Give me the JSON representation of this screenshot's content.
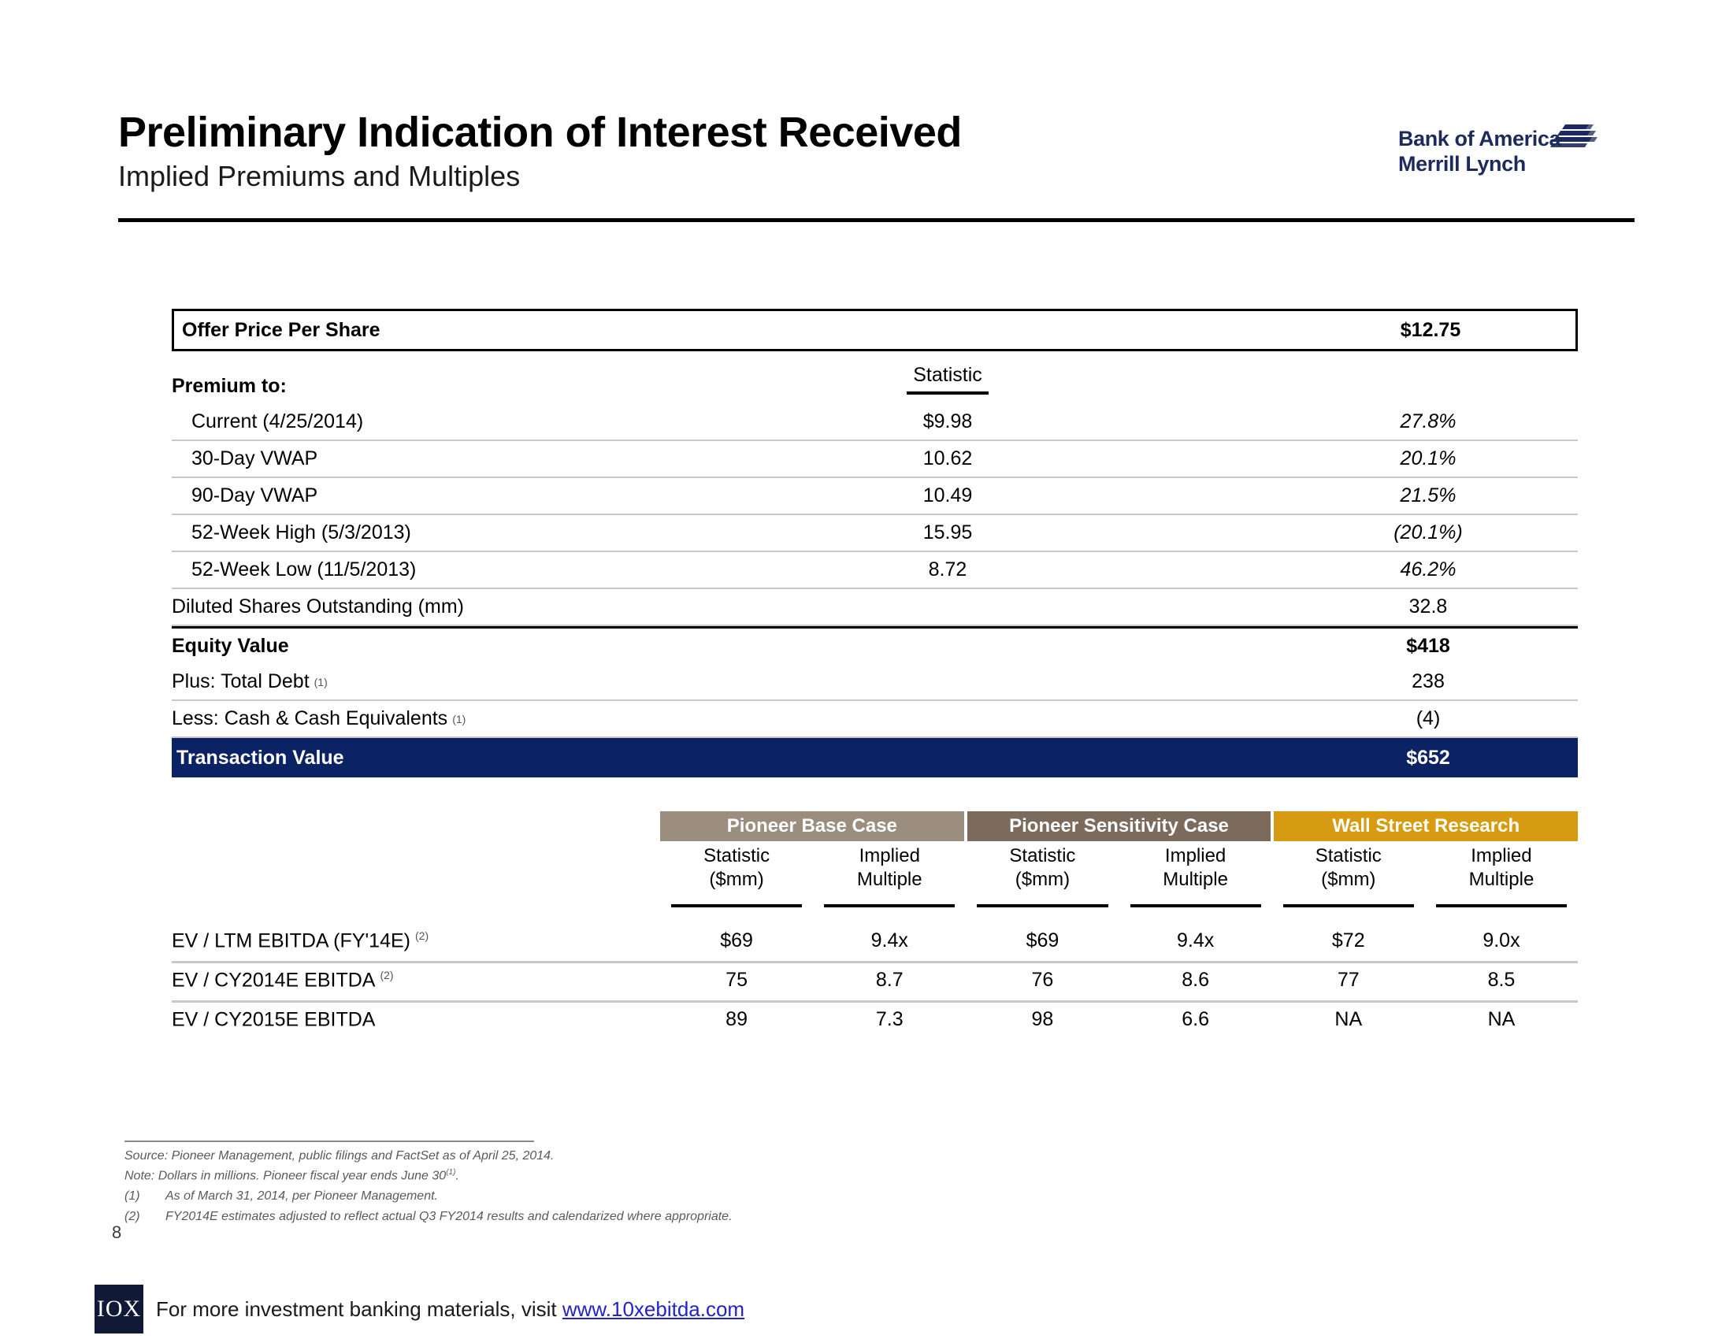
{
  "header": {
    "title": "Preliminary Indication of Interest Received",
    "subtitle": "Implied Premiums and Multiples",
    "logo": {
      "line1": "Bank of America",
      "line2": "Merrill Lynch"
    }
  },
  "premium_table": {
    "offer_label": "Offer Price Per Share",
    "offer_value": "$12.75",
    "premium_to_label": "Premium to:",
    "statistic_header": "Statistic",
    "rows": [
      {
        "label": "Current (4/25/2014)",
        "statistic": "$9.98",
        "premium": "27.8%"
      },
      {
        "label": "30-Day VWAP",
        "statistic": "10.62",
        "premium": "20.1%"
      },
      {
        "label": "90-Day VWAP",
        "statistic": "10.49",
        "premium": "21.5%"
      },
      {
        "label": "52-Week High (5/3/2013)",
        "statistic": "15.95",
        "premium": "(20.1%)"
      },
      {
        "label": "52-Week Low (11/5/2013)",
        "statistic": "8.72",
        "premium": "46.2%"
      }
    ],
    "diluted_shares_label": "Diluted Shares Outstanding (mm)",
    "diluted_shares_value": "32.8",
    "equity_value_label": "Equity Value",
    "equity_value": "$418",
    "total_debt_label": "Plus: Total Debt",
    "total_debt_footnote": "(1)",
    "total_debt_value": "238",
    "cash_label": "Less: Cash & Cash Equivalents",
    "cash_footnote": "(1)",
    "cash_value": "(4)",
    "transaction_value_label": "Transaction Value",
    "transaction_value": "$652"
  },
  "multiples_table": {
    "cases": [
      {
        "name": "Pioneer Base Case",
        "color": "#9b8e7e"
      },
      {
        "name": "Pioneer Sensitivity Case",
        "color": "#7c6b5c"
      },
      {
        "name": "Wall Street Research",
        "color": "#d79b12"
      }
    ],
    "sub_headers": [
      {
        "line1": "Statistic",
        "line2": "($mm)"
      },
      {
        "line1": "Implied",
        "line2": "Multiple"
      },
      {
        "line1": "Statistic",
        "line2": "($mm)"
      },
      {
        "line1": "Implied",
        "line2": "Multiple"
      },
      {
        "line1": "Statistic",
        "line2": "($mm)"
      },
      {
        "line1": "Implied",
        "line2": "Multiple"
      }
    ],
    "rows": [
      {
        "label": "EV / LTM EBITDA (FY'14E)",
        "footnote": "(2)",
        "values": [
          "$69",
          "9.4x",
          "$69",
          "9.4x",
          "$72",
          "9.0x"
        ]
      },
      {
        "label": "EV / CY2014E EBITDA",
        "footnote": "(2)",
        "values": [
          "75",
          "8.7",
          "76",
          "8.6",
          "77",
          "8.5"
        ]
      },
      {
        "label": "EV / CY2015E EBITDA",
        "footnote": "",
        "values": [
          "89",
          "7.3",
          "98",
          "6.6",
          "NA",
          "NA"
        ]
      }
    ]
  },
  "footnotes": {
    "source": "Source: Pioneer Management, public filings and FactSet as of April 25, 2014.",
    "note_prefix": "Note: Dollars in millions.  Pioneer fiscal year ends June 30",
    "note_sup": "(1)",
    "note_suffix": ".",
    "items": [
      {
        "num": "(1)",
        "text": "As of March 31, 2014, per Pioneer Management."
      },
      {
        "num": "(2)",
        "text": "FY2014E estimates adjusted to reflect actual Q3 FY2014 results and calendarized where appropriate."
      }
    ]
  },
  "page_number": "8",
  "brand": {
    "logo_text": "IOX",
    "text_before": "For more investment banking materials, visit ",
    "link": "www.10xebitda.com"
  },
  "colors": {
    "transaction_bar": "#0b2265",
    "logo_navy": "#1d2a5e",
    "link_blue": "#2222cc"
  }
}
